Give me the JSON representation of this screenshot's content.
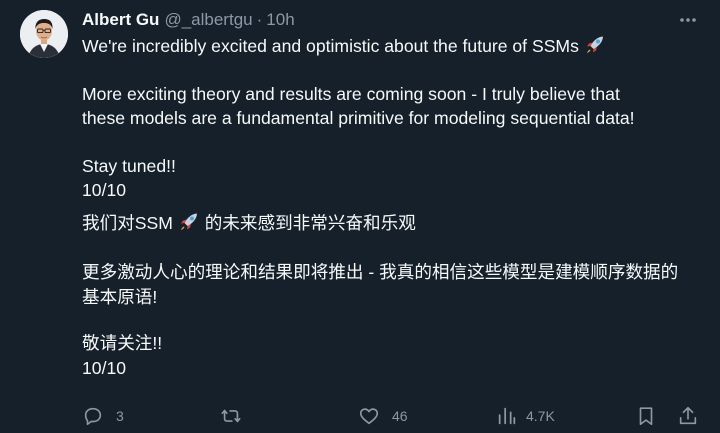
{
  "tweet": {
    "author": {
      "display_name": "Albert Gu",
      "handle": "@_albertgu",
      "separator": "·",
      "time": "10h"
    },
    "lines": {
      "l1": "We're incredibly excited and optimistic about the future of SSMs",
      "l2": "More exciting theory and results are coming soon - I truly believe that",
      "l3": "these models are a fundamental primitive for modeling sequential data!",
      "l4": "Stay tuned!!",
      "l5": "10/10",
      "l6a": "我们对SSM",
      "l6b": "的未来感到非常兴奋和乐观",
      "l7": "更多激动人心的理论和结果即将推出 - 我真的相信这些模型是建模顺序数据的",
      "l8": "基本原语!",
      "l9": "敬请关注!!",
      "l10": "10/10"
    },
    "icons": {
      "rocket": "rocket-icon",
      "more": "more-icon",
      "reply": "reply-icon",
      "retweet": "retweet-icon",
      "like": "heart-icon",
      "views": "views-icon",
      "bookmark": "bookmark-icon",
      "share": "share-icon"
    },
    "actions": {
      "replies": "3",
      "likes": "46",
      "views": "4.7K"
    },
    "colors": {
      "background": "#15202b",
      "text": "#f7f9f9",
      "secondary": "#8b98a5"
    }
  }
}
